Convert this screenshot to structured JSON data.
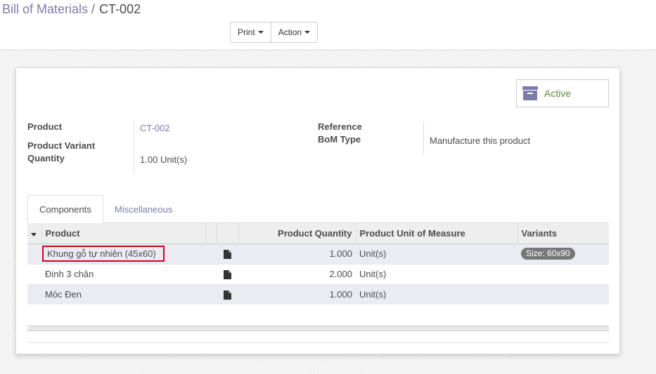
{
  "breadcrumb": {
    "parent": "Bill of Materials",
    "separator": "/",
    "current": "CT-002"
  },
  "toolbar": {
    "print_label": "Print",
    "action_label": "Action"
  },
  "status_button": {
    "label": "Active",
    "icon": "archive-icon",
    "color": "#5a8a3a"
  },
  "fields": {
    "product_label": "Product",
    "product_value": "CT-002",
    "variant_label": "Product Variant",
    "quantity_label": "Quantity",
    "quantity_value": "1.00",
    "quantity_unit": "Unit(s)",
    "reference_label": "Reference",
    "bom_type_label": "BoM Type",
    "bom_type_value": "Manufacture this product"
  },
  "tabs": [
    {
      "label": "Components",
      "active": true
    },
    {
      "label": "Miscellaneous",
      "active": false
    }
  ],
  "table": {
    "columns": [
      "Product",
      "",
      "",
      "Product Quantity",
      "Product Unit of Measure",
      "Variants"
    ],
    "rows": [
      {
        "product": "Khung gỗ tự nhiên (45x60)",
        "quantity": "1.000",
        "uom": "Unit(s)",
        "variant": "Size: 60x90",
        "highlighted": true
      },
      {
        "product": "Đinh 3 chân",
        "quantity": "2.000",
        "uom": "Unit(s)",
        "variant": ""
      },
      {
        "product": "Móc Đen",
        "quantity": "1.000",
        "uom": "Unit(s)",
        "variant": ""
      }
    ]
  },
  "colors": {
    "accent": "#7c7bad",
    "highlight": "#d0021b",
    "badge": "#777777"
  }
}
